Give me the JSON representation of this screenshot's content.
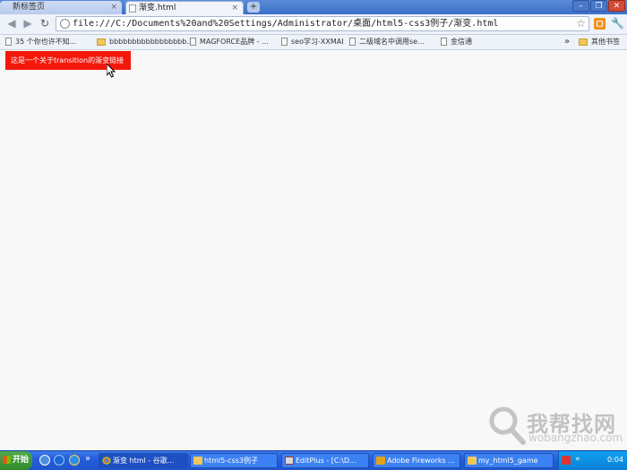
{
  "browser": {
    "tabs": [
      {
        "label": "新标签页",
        "active": false
      },
      {
        "label": "渐变.html",
        "active": true
      }
    ],
    "new_tab_symbol": "+",
    "close_symbol": "×",
    "window_buttons": {
      "minimize": "–",
      "restore": "❐",
      "close": "✕"
    },
    "url": "file:///C:/Documents%20and%20Settings/Administrator/桌面/html5-css3例子/渐变.html",
    "icons": {
      "back": "left-arrow-icon",
      "forward": "right-arrow-icon",
      "reload": "reload-icon",
      "star": "star-icon",
      "wrench": "wrench-icon"
    }
  },
  "bookmarks": {
    "items": [
      {
        "label": "35 个你也许不知...",
        "icon": "page"
      },
      {
        "label": "bbbbbbbbbbbbbbbbb...",
        "icon": "folder"
      },
      {
        "label": "MAGFORCE品牌 - ...",
        "icon": "page"
      },
      {
        "label": "seo学习-XXMAI",
        "icon": "page"
      },
      {
        "label": "二级域名中调用se...",
        "icon": "page"
      },
      {
        "label": "金信通",
        "icon": "page"
      }
    ],
    "overflow": "»",
    "other_bookmarks": "其他书签"
  },
  "page": {
    "link_text": "这是一个关于transition的渐变链接",
    "link_color": "#f4180b"
  },
  "watermark": {
    "text": "我帮找网",
    "url": "wobangzhao.com"
  },
  "taskbar": {
    "start_label": "开始",
    "quick_launch_more": "»",
    "buttons": [
      {
        "label": "渐变 html - 谷歌...",
        "active": true
      },
      {
        "label": "html5-css3例子",
        "active": false
      },
      {
        "label": "EditPlus - [C:\\D...",
        "active": false
      },
      {
        "label": "Adobe Fireworks ...",
        "active": false
      },
      {
        "label": "my_html5_game",
        "active": false
      }
    ],
    "tray_chevron": "«",
    "clock": "0:04"
  }
}
